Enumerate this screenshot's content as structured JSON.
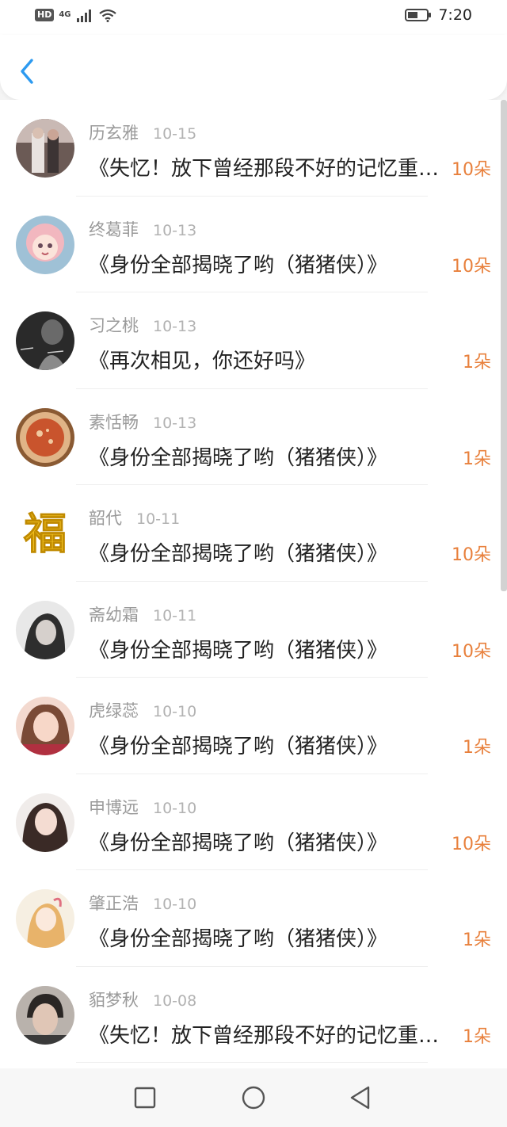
{
  "status_bar": {
    "hd_label": "HD",
    "network_label": "4G",
    "time": "7:20"
  },
  "colors": {
    "accent_blue": "#2d9af0",
    "flower_orange": "#e8803c"
  },
  "list": {
    "items": [
      {
        "name": "历玄雅",
        "date": "10-15",
        "title": "《失忆！放下曾经那段不好的记忆重新开始》",
        "flowers": "10朵"
      },
      {
        "name": "终葛菲",
        "date": "10-13",
        "title": "《身份全部揭晓了哟（猪猪侠）》",
        "flowers": "10朵"
      },
      {
        "name": "习之桃",
        "date": "10-13",
        "title": "《再次相见，你还好吗》",
        "flowers": "1朵"
      },
      {
        "name": "素恬畅",
        "date": "10-13",
        "title": "《身份全部揭晓了哟（猪猪侠）》",
        "flowers": "1朵"
      },
      {
        "name": "韶代",
        "date": "10-11",
        "title": "《身份全部揭晓了哟（猪猪侠）》",
        "flowers": "10朵"
      },
      {
        "name": "斋幼霜",
        "date": "10-11",
        "title": "《身份全部揭晓了哟（猪猪侠）》",
        "flowers": "10朵"
      },
      {
        "name": "虎绿蕊",
        "date": "10-10",
        "title": "《身份全部揭晓了哟（猪猪侠）》",
        "flowers": "1朵"
      },
      {
        "name": "申博远",
        "date": "10-10",
        "title": "《身份全部揭晓了哟（猪猪侠）》",
        "flowers": "10朵"
      },
      {
        "name": "肇正浩",
        "date": "10-10",
        "title": "《身份全部揭晓了哟（猪猪侠）》",
        "flowers": "1朵"
      },
      {
        "name": "貊梦秋",
        "date": "10-08",
        "title": "《失忆！放下曾经那段不好的记忆重新开始》",
        "flowers": "1朵"
      }
    ],
    "avatar_fu_text": "福"
  }
}
